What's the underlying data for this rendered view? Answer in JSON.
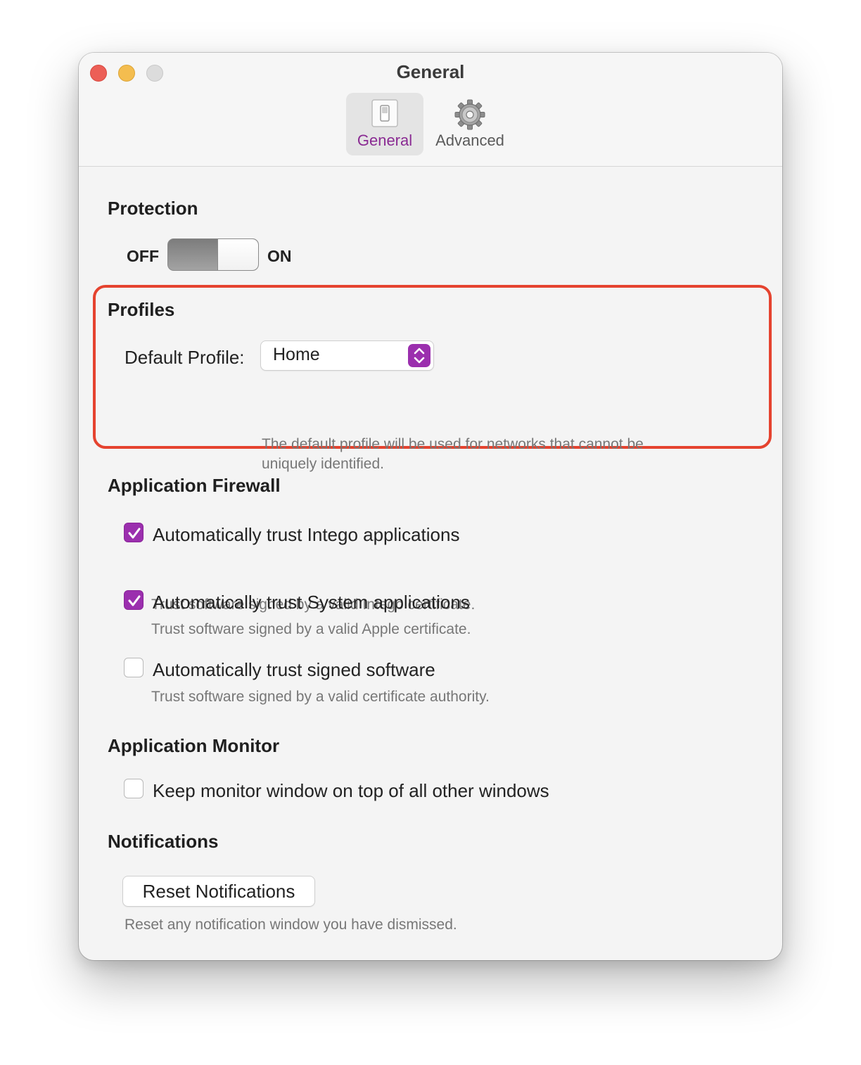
{
  "window": {
    "title": "General"
  },
  "toolbar": {
    "items": [
      {
        "label": "General",
        "icon": "switch-icon",
        "selected": true
      },
      {
        "label": "Advanced",
        "icon": "gear-icon",
        "selected": false
      }
    ]
  },
  "protection": {
    "title": "Protection",
    "off_label": "OFF",
    "on_label": "ON",
    "state": "on"
  },
  "profiles": {
    "title": "Profiles",
    "default_label": "Default Profile:",
    "selected": "Home",
    "description_line1": "The default profile will be used for networks that cannot be",
    "description_line2": "uniquely identified."
  },
  "firewall": {
    "title": "Application Firewall",
    "options": [
      {
        "label": "Automatically trust Intego applications",
        "description": "Trust software signed by a valid Intego certificate.",
        "checked": true
      },
      {
        "label": "Automatically trust System applications",
        "description": "Trust software signed by a valid Apple certificate.",
        "checked": true
      },
      {
        "label": "Automatically trust signed software",
        "description": "Trust software signed by a valid certificate authority.",
        "checked": false
      }
    ]
  },
  "monitor": {
    "title": "Application Monitor",
    "option": {
      "label": "Keep monitor window on top of all other windows",
      "checked": false
    }
  },
  "notifications": {
    "title": "Notifications",
    "button_label": "Reset Notifications",
    "description": "Reset any notification window you have dismissed."
  },
  "colors": {
    "accent": "#9b2fae",
    "highlight": "#e5432f"
  }
}
